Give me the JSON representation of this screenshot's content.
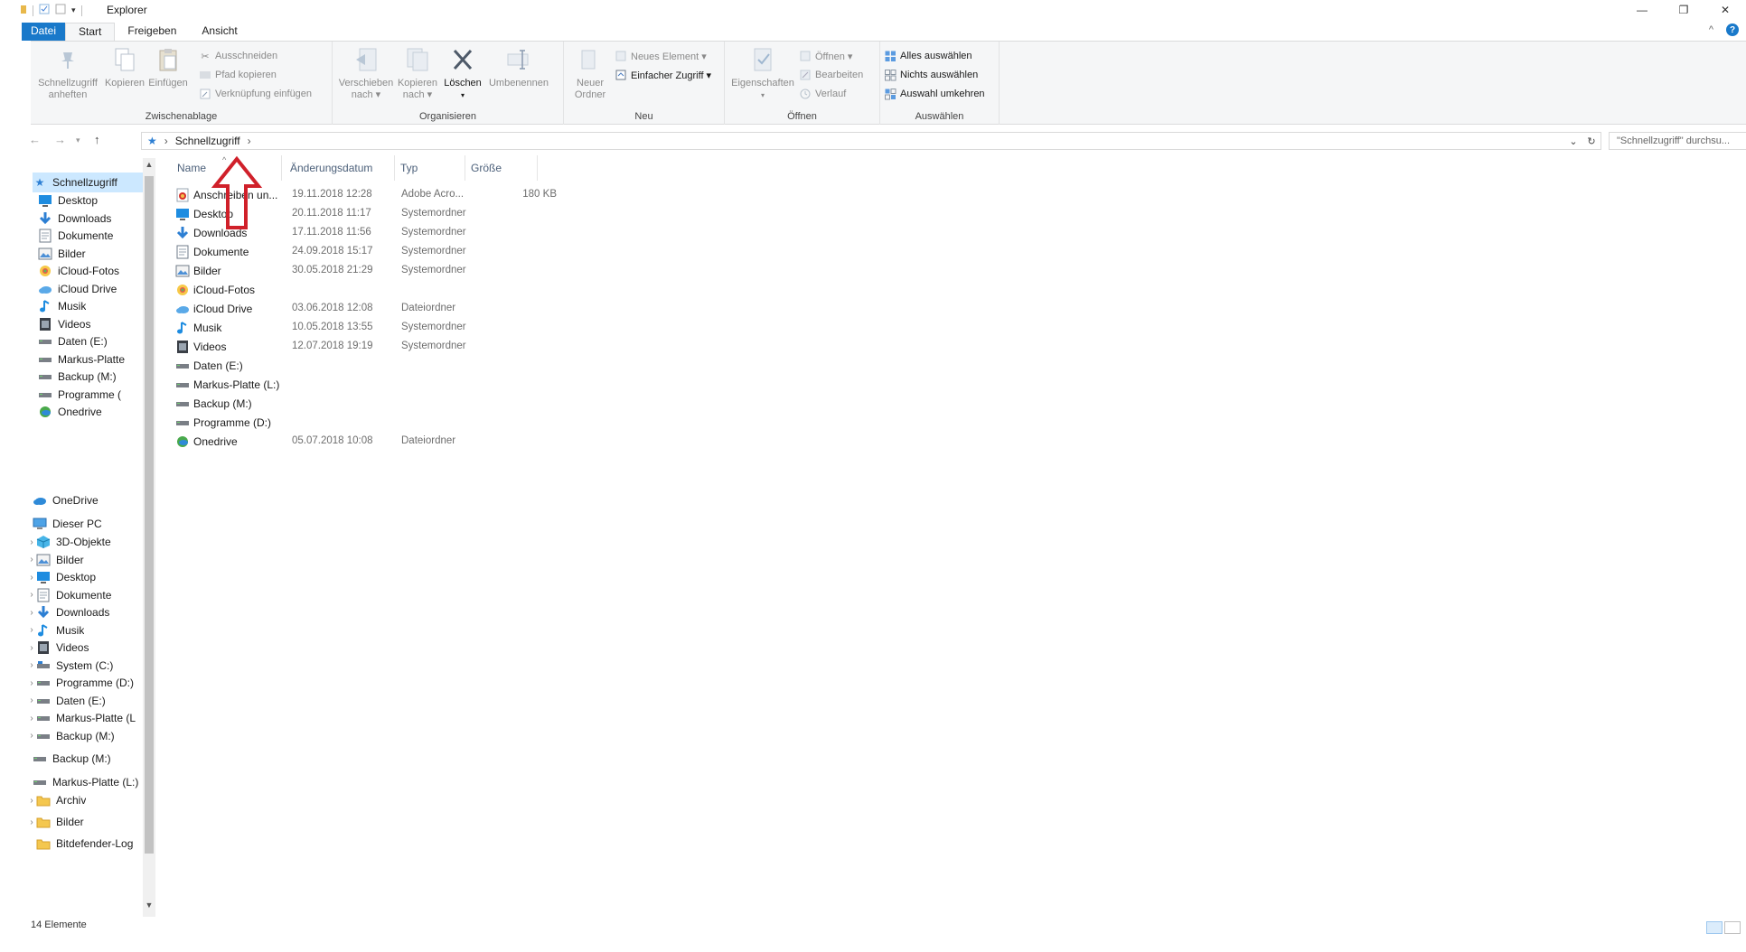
{
  "window": {
    "title": "Explorer",
    "minimize": "—",
    "restore": "❐",
    "close": "✕"
  },
  "ribbon_tabs": {
    "file": "Datei",
    "start": "Start",
    "share": "Freigeben",
    "view": "Ansicht"
  },
  "ribbon": {
    "clipboard": {
      "label": "Zwischenablage",
      "pin": "Schnellzugriff\nanheften",
      "copy": "Kopieren",
      "paste": "Einfügen",
      "cut": "Ausschneiden",
      "copy_path": "Pfad kopieren",
      "paste_shortcut": "Verknüpfung einfügen"
    },
    "organize": {
      "label": "Organisieren",
      "move_to": "Verschieben\nnach ▾",
      "copy_to": "Kopieren\nnach ▾",
      "delete": "Löschen",
      "delete_arrow": "▾",
      "rename": "Umbenennen"
    },
    "new": {
      "label": "Neu",
      "new_folder": "Neuer\nOrdner",
      "new_item": "Neues Element ▾",
      "easy_access": "Einfacher Zugriff ▾"
    },
    "open": {
      "label": "Öffnen",
      "properties": "Eigenschaften",
      "properties_arrow": "▾",
      "open": "Öffnen ▾",
      "edit": "Bearbeiten",
      "history": "Verlauf"
    },
    "select": {
      "label": "Auswählen",
      "select_all": "Alles auswählen",
      "select_none": "Nichts auswählen",
      "invert": "Auswahl umkehren"
    }
  },
  "address": {
    "path_segment": "Schnellzugriff",
    "separator": "›",
    "search_placeholder": "\"Schnellzugriff\" durchsu..."
  },
  "nav_pane": {
    "quick_access": "Schnellzugriff",
    "quick_items": [
      {
        "label": "Desktop",
        "icon": "desktop-icon"
      },
      {
        "label": "Downloads",
        "icon": "download-icon"
      },
      {
        "label": "Dokumente",
        "icon": "document-icon"
      },
      {
        "label": "Bilder",
        "icon": "pictures-icon"
      },
      {
        "label": "iCloud-Fotos",
        "icon": "icloud-photos-icon"
      },
      {
        "label": "iCloud Drive",
        "icon": "icloud-drive-icon"
      },
      {
        "label": "Musik",
        "icon": "music-icon"
      },
      {
        "label": "Videos",
        "icon": "video-icon"
      },
      {
        "label": "Daten (E:)",
        "icon": "drive-icon"
      },
      {
        "label": "Markus-Platte",
        "icon": "drive-icon"
      },
      {
        "label": "Backup (M:)",
        "icon": "drive-icon"
      },
      {
        "label": "Programme (",
        "icon": "drive-icon"
      },
      {
        "label": "Onedrive",
        "icon": "onedrive-icon"
      }
    ],
    "onedrive": "OneDrive",
    "this_pc": "Dieser PC",
    "pc_items": [
      "3D-Objekte",
      "Bilder",
      "Desktop",
      "Dokumente",
      "Downloads",
      "Musik",
      "Videos",
      "System (C:)",
      "Programme (D:)",
      "Daten (E:)",
      "Markus-Platte (L",
      "Backup (M:)"
    ],
    "backup_drive": "Backup (M:)",
    "markus_drive": "Markus-Platte (L:)",
    "folders": [
      "Archiv",
      "Bilder",
      "Bitdefender-Log"
    ]
  },
  "columns": {
    "name": "Name",
    "date": "Änderungsdatum",
    "type": "Typ",
    "size": "Größe",
    "sort_indicator": "^"
  },
  "files": [
    {
      "name": "Anschreiben un...",
      "date": "19.11.2018 12:28",
      "type": "Adobe Acro...",
      "size": "180 KB",
      "icon": "pdf-icon"
    },
    {
      "name": "Desktop",
      "date": "20.11.2018 11:17",
      "type": "Systemordner",
      "size": "",
      "icon": "desktop-icon"
    },
    {
      "name": "Downloads",
      "date": "17.11.2018 11:56",
      "type": "Systemordner",
      "size": "",
      "icon": "download-icon"
    },
    {
      "name": "Dokumente",
      "date": "24.09.2018 15:17",
      "type": "Systemordner",
      "size": "",
      "icon": "document-icon"
    },
    {
      "name": "Bilder",
      "date": "30.05.2018 21:29",
      "type": "Systemordner",
      "size": "",
      "icon": "pictures-icon"
    },
    {
      "name": "iCloud-Fotos",
      "date": "",
      "type": "",
      "size": "",
      "icon": "icloud-photos-icon"
    },
    {
      "name": "iCloud Drive",
      "date": "03.06.2018 12:08",
      "type": "Dateiordner",
      "size": "",
      "icon": "icloud-drive-icon"
    },
    {
      "name": "Musik",
      "date": "10.05.2018 13:55",
      "type": "Systemordner",
      "size": "",
      "icon": "music-icon"
    },
    {
      "name": "Videos",
      "date": "12.07.2018 19:19",
      "type": "Systemordner",
      "size": "",
      "icon": "video-icon"
    },
    {
      "name": "Daten (E:)",
      "date": "",
      "type": "",
      "size": "",
      "icon": "drive-icon"
    },
    {
      "name": "Markus-Platte (L:)",
      "date": "",
      "type": "",
      "size": "",
      "icon": "drive-icon"
    },
    {
      "name": "Backup (M:)",
      "date": "",
      "type": "",
      "size": "",
      "icon": "drive-icon"
    },
    {
      "name": "Programme (D:)",
      "date": "",
      "type": "",
      "size": "",
      "icon": "drive-icon"
    },
    {
      "name": "Onedrive",
      "date": "05.07.2018 10:08",
      "type": "Dateiordner",
      "size": "",
      "icon": "onedrive-icon"
    }
  ],
  "status": {
    "item_count": "14 Elemente"
  },
  "colors": {
    "accent": "#1979ca",
    "selection": "#cce8ff",
    "annotation": "#d0202a"
  }
}
